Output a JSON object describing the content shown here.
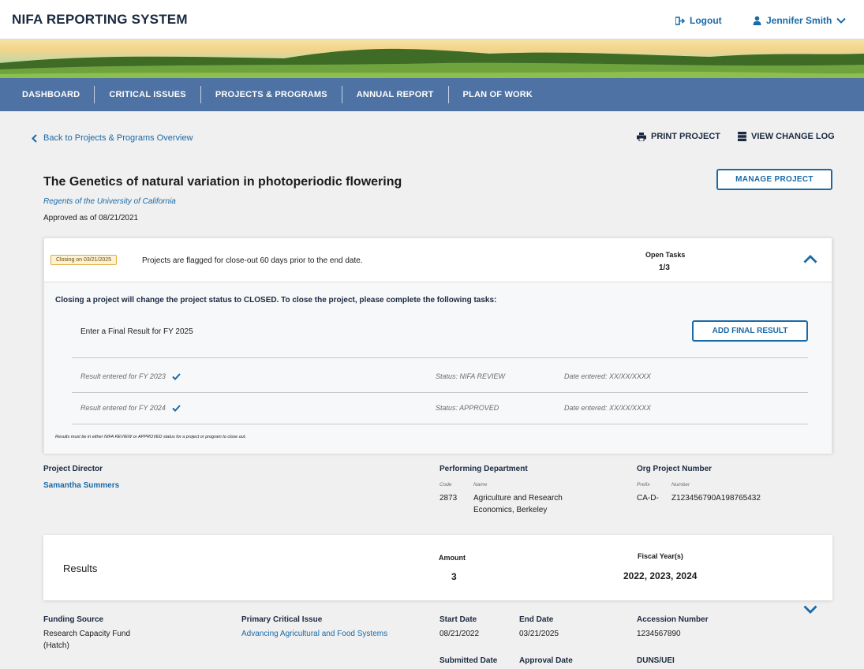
{
  "header": {
    "app_title": "NIFA REPORTING SYSTEM",
    "logout_label": "Logout",
    "user_name": "Jennifer Smith"
  },
  "nav": {
    "items": [
      "DASHBOARD",
      "CRITICAL ISSUES",
      "PROJECTS & PROGRAMS",
      "ANNUAL REPORT",
      "PLAN OF WORK"
    ]
  },
  "actions": {
    "back_label": "Back to Projects & Programs Overview",
    "print_label": "PRINT PROJECT",
    "changelog_label": "VIEW CHANGE LOG",
    "manage_label": "MANAGE PROJECT"
  },
  "project": {
    "title": "The Genetics of natural variation in photoperiodic flowering",
    "institution": "Regents of the University of California",
    "approved": "Approved as of 08/21/2021"
  },
  "closeout": {
    "badge": "Closing on 03/21/2025",
    "flag_text": "Projects are flagged for close-out 60 days prior to the end date.",
    "open_tasks_label": "Open Tasks",
    "open_tasks_value": "1/3",
    "instructions": "Closing a project will change the project status to CLOSED. To close the project, please complete the following tasks:",
    "final_task": "Enter a Final Result for FY 2025",
    "add_final_label": "ADD FINAL RESULT",
    "rows": [
      {
        "label": "Result entered for FY 2023",
        "status": "Status: NIFA REVIEW",
        "date": "Date entered: XX/XX/XXXX"
      },
      {
        "label": "Result entered for FY 2024",
        "status": "Status: APPROVED",
        "date": "Date entered: XX/XX/XXXX"
      }
    ],
    "note": "Results must be in either NIFA REVIEW or APPROVED status for a project or program to close out."
  },
  "details": {
    "director_label": "Project Director",
    "director_name": "Samantha Summers",
    "dept_label": "Performing Department",
    "dept_code_label": "Code",
    "dept_name_label": "Name",
    "dept_code": "2873",
    "dept_name_1": "Agriculture and Research",
    "dept_name_2": "Economics, Berkeley",
    "org_label": "Org Project Number",
    "org_prefix_label": "Prefix",
    "org_number_label": "Number",
    "org_prefix": "CA-D-",
    "org_number": "Z123456790A198765432"
  },
  "results": {
    "title": "Results",
    "amount_label": "Amount",
    "amount_value": "3",
    "fy_label": "Fiscal Year(s)",
    "fy_value": "2022, 2023, 2024"
  },
  "funding": {
    "source_label": "Funding Source",
    "source_1": "Research Capacity Fund",
    "source_2": "(Hatch)",
    "issue_label": "Primary Critical Issue",
    "issue_value": "Advancing Agricultural and Food Systems",
    "start_label": "Start Date",
    "start_value": "08/21/2022",
    "end_label": "End Date",
    "end_value": "03/21/2025",
    "accession_label": "Accession Number",
    "accession_value": "1234567890",
    "submitted_label": "Submitted Date",
    "approval_label": "Approval Date",
    "duns_label": "DUNS/UEI"
  },
  "colors": {
    "nav_bg": "#4e72a3",
    "link": "#1a6aa7",
    "badge_bg": "#fdf1d6",
    "badge_border": "#e2a93b"
  }
}
